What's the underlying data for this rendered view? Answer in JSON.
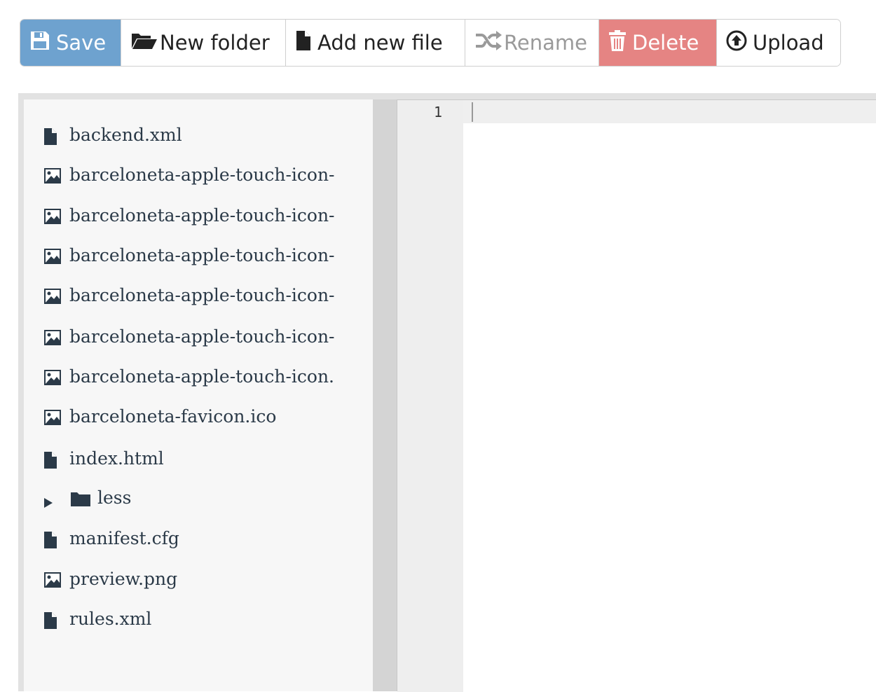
{
  "toolbar": {
    "save": {
      "label": "Save",
      "icon": "floppy-disk-icon"
    },
    "new_folder": {
      "label": "New folder",
      "icon": "folder-open-icon"
    },
    "add_file": {
      "label": "Add new file",
      "icon": "file-icon"
    },
    "rename": {
      "label": "Rename",
      "icon": "shuffle-icon"
    },
    "delete": {
      "label": "Delete",
      "icon": "trash-icon"
    },
    "upload": {
      "label": "Upload",
      "icon": "upload-circle-icon"
    }
  },
  "colors": {
    "primary": "#6ea2cf",
    "danger": "#e58483",
    "tree_text": "#2b3a48"
  },
  "file_tree": {
    "items": [
      {
        "label": "backend.xml",
        "type": "file"
      },
      {
        "label": "barceloneta-apple-touch-icon-",
        "type": "image"
      },
      {
        "label": "barceloneta-apple-touch-icon-",
        "type": "image"
      },
      {
        "label": "barceloneta-apple-touch-icon-",
        "type": "image"
      },
      {
        "label": "barceloneta-apple-touch-icon-",
        "type": "image"
      },
      {
        "label": "barceloneta-apple-touch-icon-",
        "type": "image"
      },
      {
        "label": "barceloneta-apple-touch-icon.",
        "type": "image"
      },
      {
        "label": "barceloneta-favicon.ico",
        "type": "image"
      },
      {
        "label": "index.html",
        "type": "file"
      },
      {
        "label": "less",
        "type": "folder",
        "expanded": false
      },
      {
        "label": "manifest.cfg",
        "type": "file"
      },
      {
        "label": "preview.png",
        "type": "image"
      },
      {
        "label": "rules.xml",
        "type": "file"
      }
    ]
  },
  "editor": {
    "line_numbers": [
      "1"
    ],
    "content": ""
  }
}
